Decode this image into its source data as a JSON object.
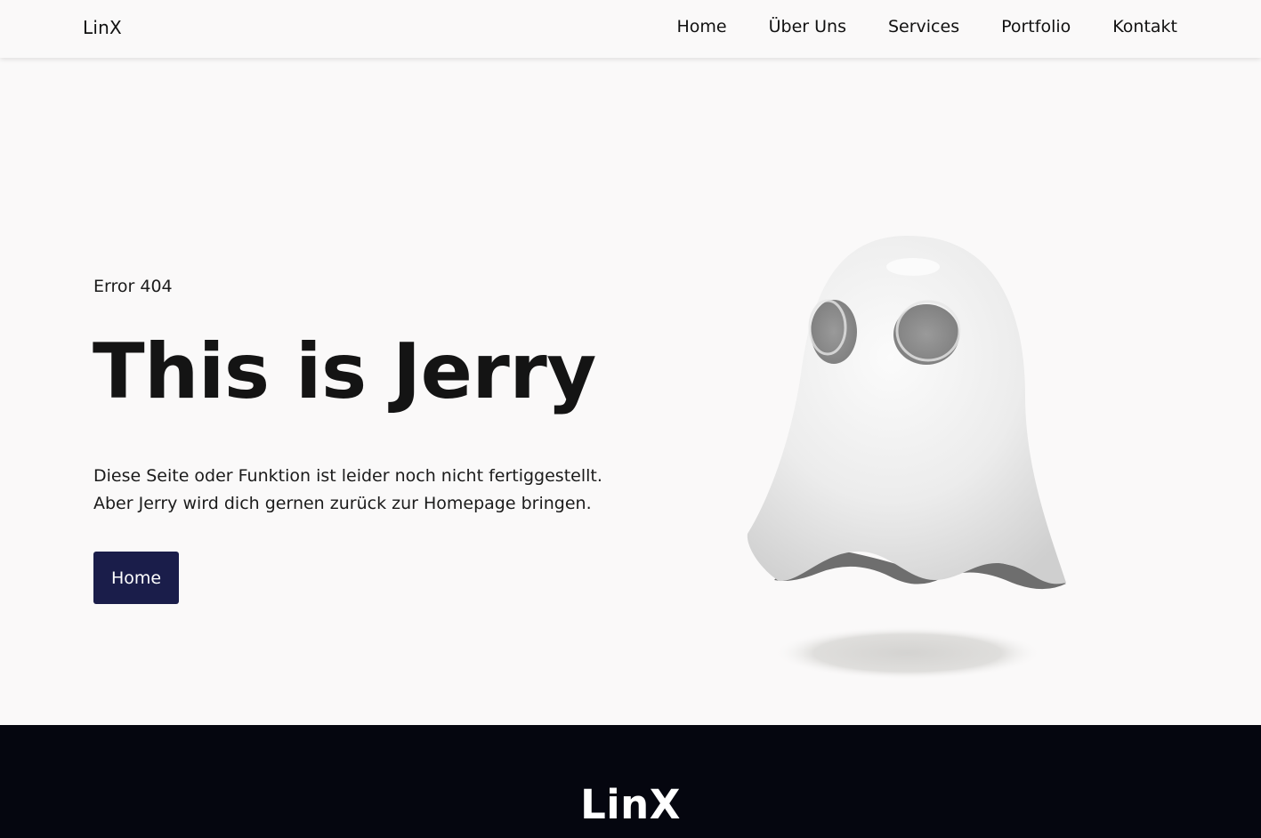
{
  "header": {
    "brand": "LinX",
    "nav": [
      {
        "label": "Home"
      },
      {
        "label": "Über Uns"
      },
      {
        "label": "Services"
      },
      {
        "label": "Portfolio"
      },
      {
        "label": "Kontakt"
      }
    ]
  },
  "hero": {
    "eyebrow": "Error 404",
    "title": "This is Jerry",
    "description_line1": "Diese Seite oder Funktion ist leider noch nicht fertiggestellt.",
    "description_line2": "Aber Jerry wird dich gernen zurück zur Homepage bringen.",
    "cta_label": "Home",
    "illustration": "ghost-illustration"
  },
  "footer": {
    "brand": "LinX"
  },
  "colors": {
    "background": "#faf9f9",
    "button": "#1a1d4a",
    "footer": "#05060f",
    "text": "#141414"
  }
}
